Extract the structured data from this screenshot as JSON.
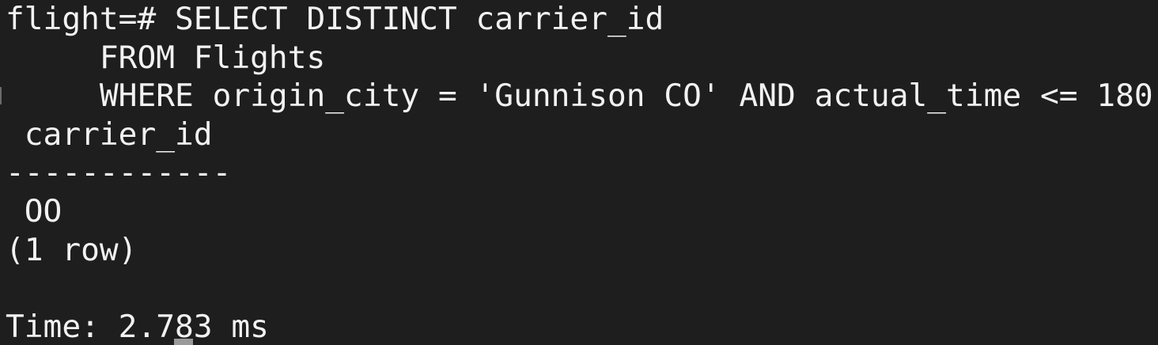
{
  "terminal": {
    "lines": [
      "flight=# SELECT DISTINCT carrier_id",
      "     FROM Flights",
      "     WHERE origin_city = 'Gunnison CO' AND actual_time <= 180",
      " carrier_id",
      "------------",
      " OO",
      "(1 row)",
      "",
      "Time: 2.783 ms"
    ]
  },
  "colors": {
    "background": "#1e1e1e",
    "text": "#f2f2f2",
    "cursor": "#9a9a9a"
  }
}
